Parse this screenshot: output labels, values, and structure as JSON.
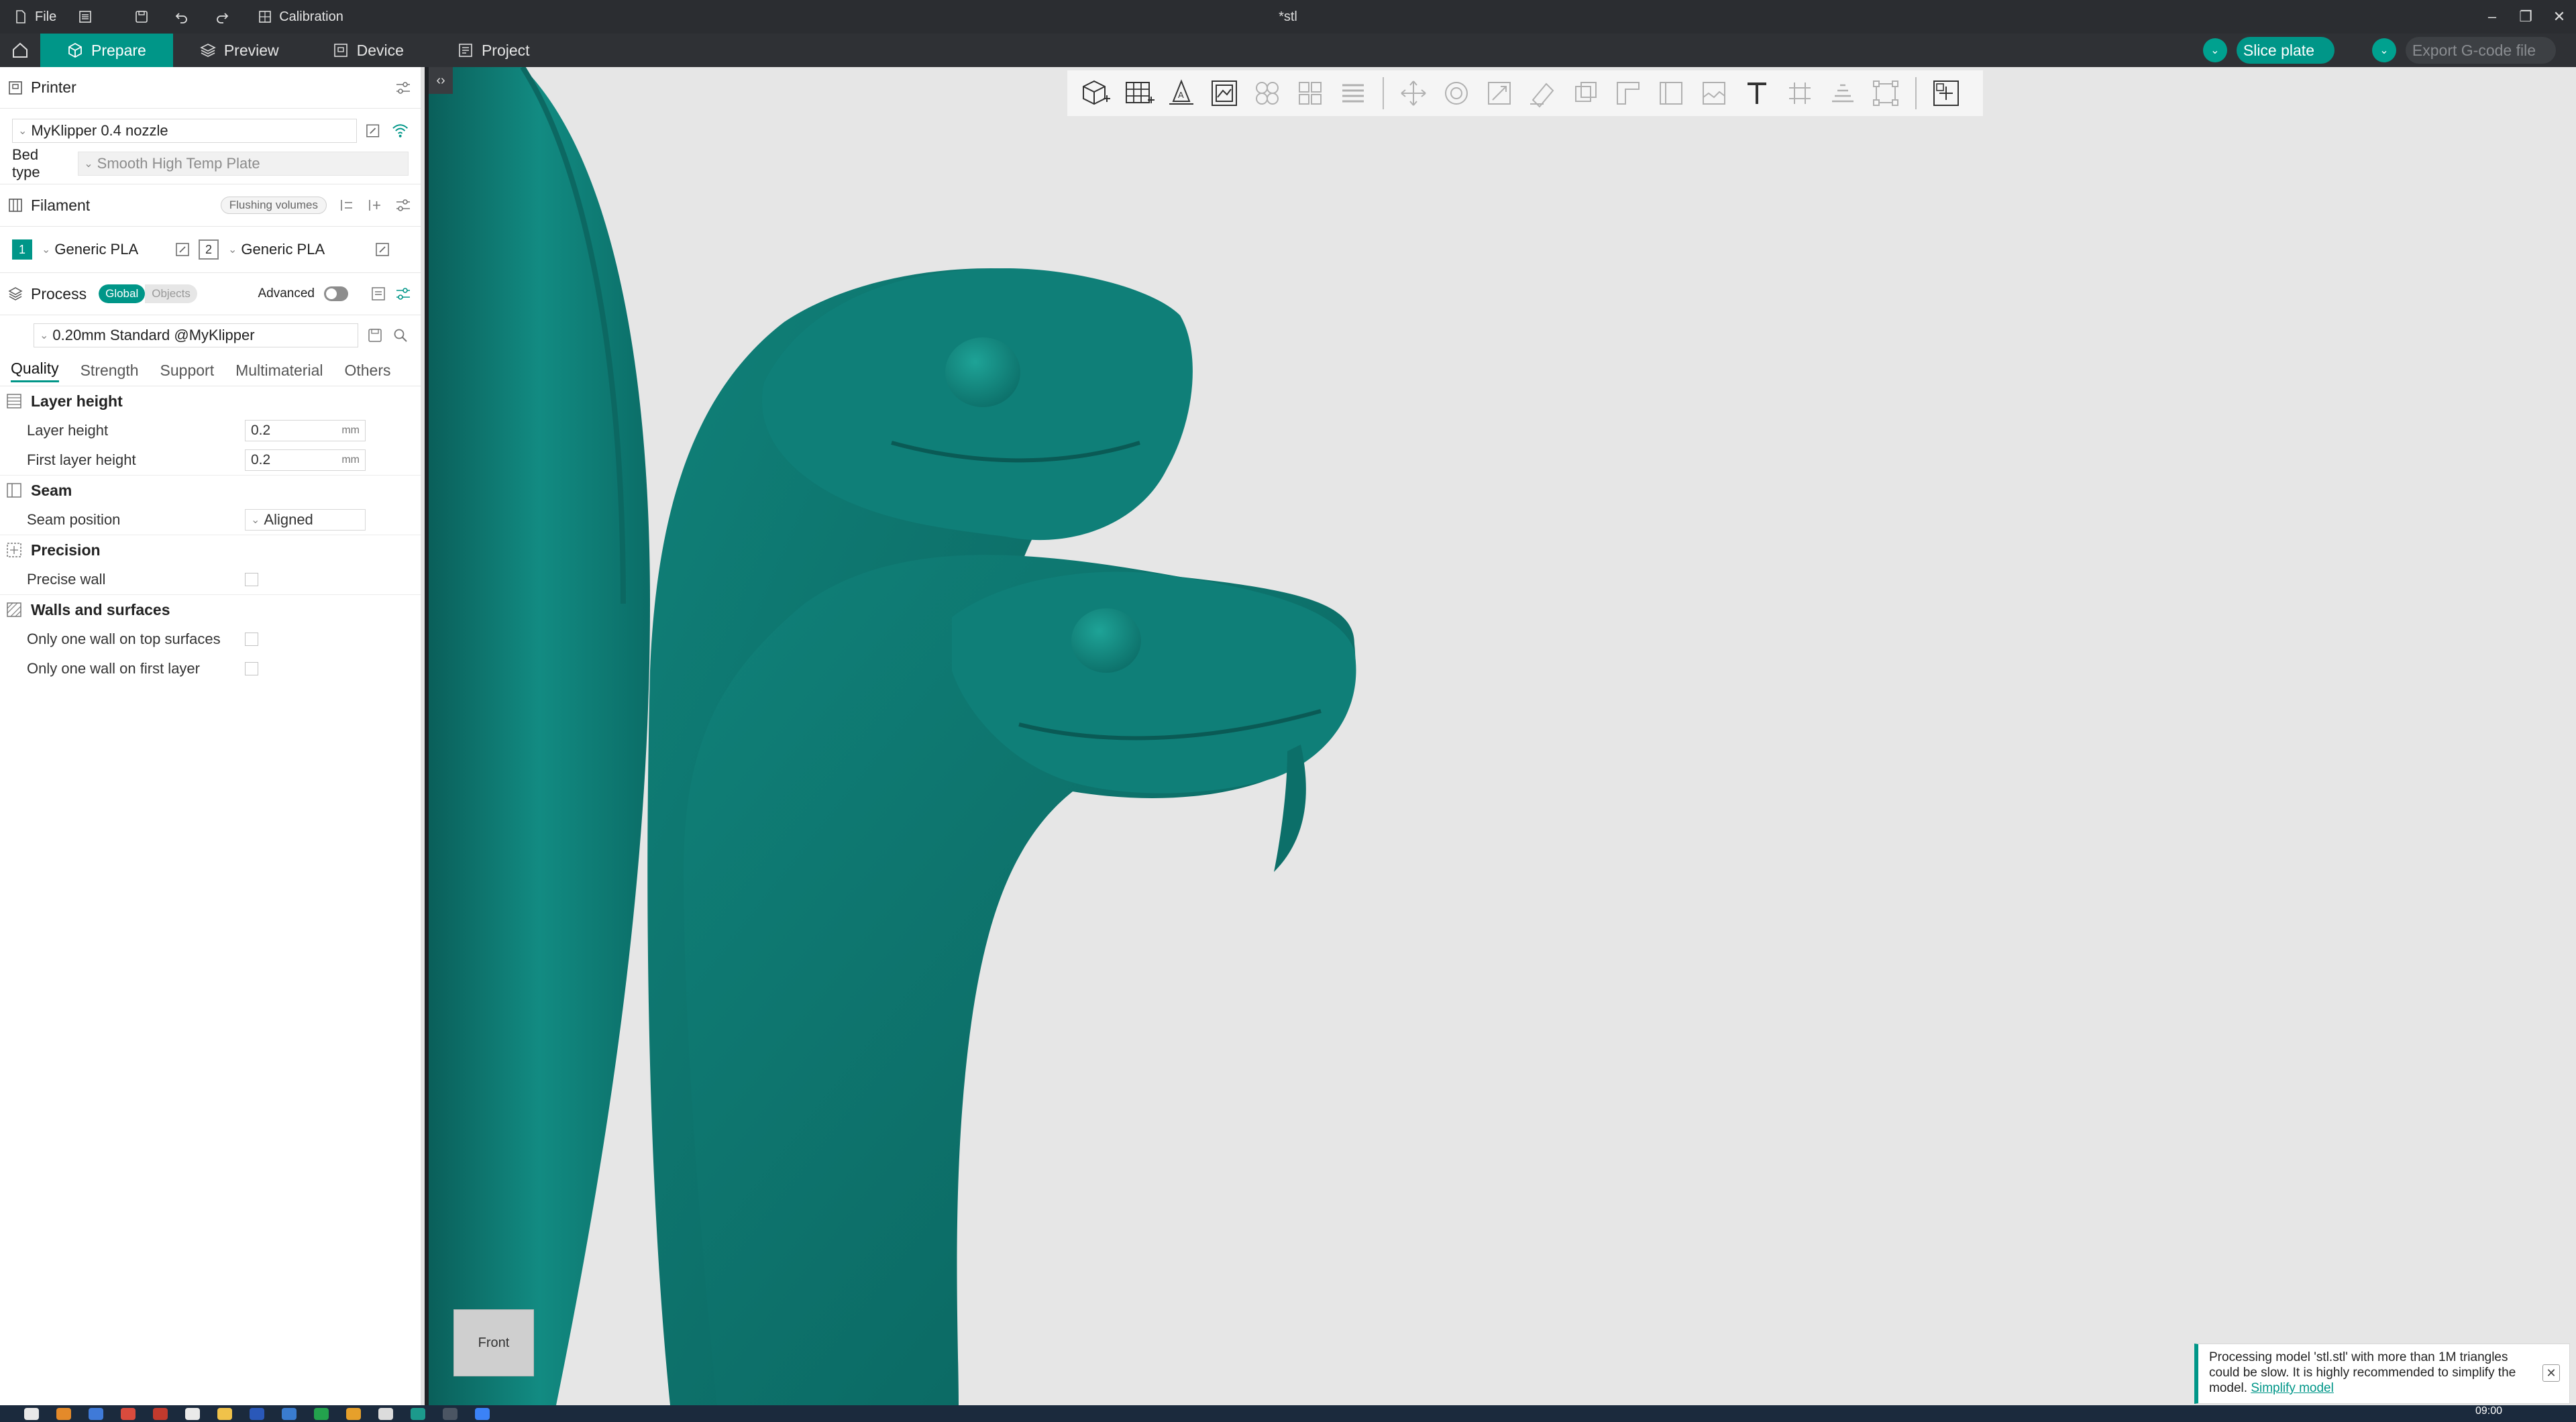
{
  "titlebar": {
    "file_label": "File",
    "calibration_label": "Calibration",
    "doc_title": "*stl"
  },
  "nav": {
    "tabs": [
      {
        "label": "Prepare",
        "icon": "cube-icon"
      },
      {
        "label": "Preview",
        "icon": "layers-icon"
      },
      {
        "label": "Device",
        "icon": "device-icon"
      },
      {
        "label": "Project",
        "icon": "project-icon"
      }
    ],
    "slice_label": "Slice plate",
    "export_label": "Export G-code file",
    "accent": "#009688"
  },
  "printer": {
    "section_label": "Printer",
    "printer_name": "MyKlipper 0.4 nozzle",
    "bed_type_label": "Bed type",
    "bed_type_value": "Smooth High Temp Plate"
  },
  "filament": {
    "section_label": "Filament",
    "flushing_label": "Flushing volumes",
    "slots": [
      {
        "num": "1",
        "name": "Generic PLA"
      },
      {
        "num": "2",
        "name": "Generic PLA"
      }
    ]
  },
  "process": {
    "section_label": "Process",
    "global_label": "Global",
    "objects_label": "Objects",
    "advanced_label": "Advanced",
    "preset": "0.20mm Standard @MyKlipper",
    "tabs": [
      "Quality",
      "Strength",
      "Support",
      "Multimaterial",
      "Others"
    ]
  },
  "quality": {
    "layer_height_group": "Layer height",
    "layer_height_label": "Layer height",
    "layer_height_value": "0.2",
    "first_layer_label": "First layer height",
    "first_layer_value": "0.2",
    "unit": "mm",
    "seam_group": "Seam",
    "seam_position_label": "Seam position",
    "seam_position_value": "Aligned",
    "precision_group": "Precision",
    "precise_wall_label": "Precise wall",
    "walls_group": "Walls and surfaces",
    "one_wall_top_label": "Only one wall on top surfaces",
    "one_wall_first_label": "Only one wall on first layer"
  },
  "viewport": {
    "navcube_label": "Front",
    "model_color": "#0f7f78",
    "notice_text": "Processing model 'stl.stl' with more than 1M triangles could be slow. It is highly recommended to simplify the model.",
    "notice_link": "Simplify model"
  },
  "taskbar": {
    "clock": "09:00"
  }
}
